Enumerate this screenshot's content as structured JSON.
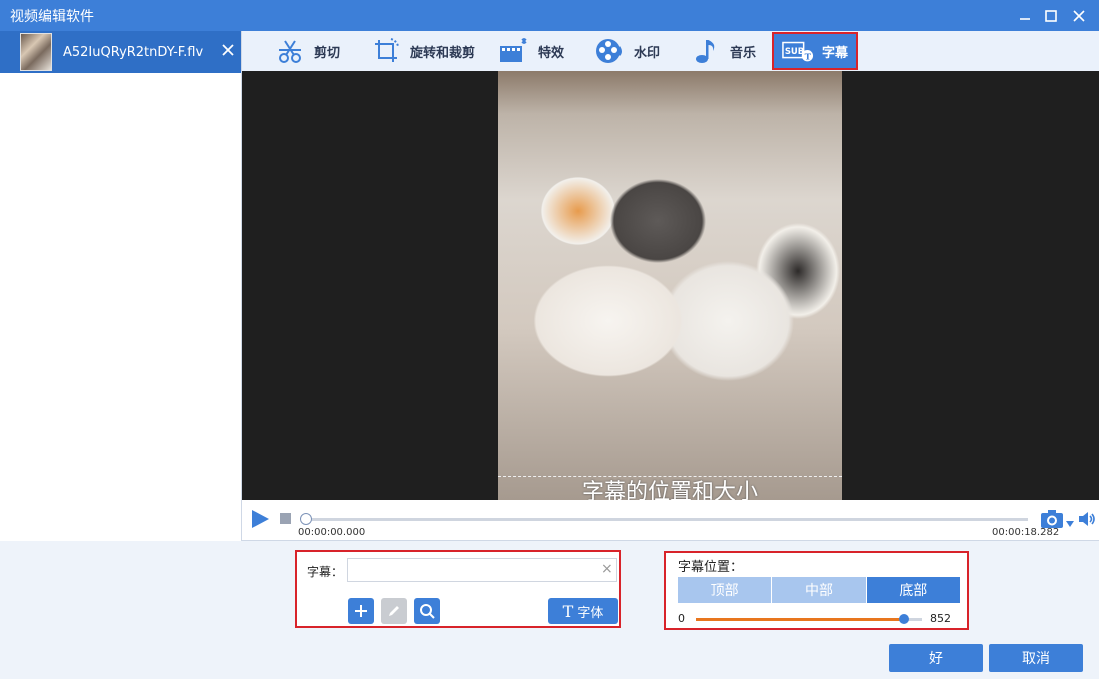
{
  "window": {
    "title": "视频编辑软件"
  },
  "files": [
    {
      "name": "A52IuQRyR2tnDY-F.flv",
      "selected": true
    }
  ],
  "tabs": [
    {
      "label": "剪切",
      "icon": "cut-icon"
    },
    {
      "label": "旋转和裁剪",
      "icon": "rotate-crop-icon"
    },
    {
      "label": "特效",
      "icon": "effects-icon"
    },
    {
      "label": "水印",
      "icon": "watermark-icon"
    },
    {
      "label": "音乐",
      "icon": "music-icon"
    },
    {
      "label": "字幕",
      "icon": "subtitle-icon",
      "active": true
    }
  ],
  "preview": {
    "subtitle_preview_text": "字幕的位置和大小"
  },
  "player": {
    "current_time": "00:00:00.000",
    "total_time": "00:00:18.282",
    "progress": 0
  },
  "subtitle": {
    "label": "字幕：",
    "value": "",
    "placeholder": "",
    "font_button": "字体"
  },
  "position": {
    "label": "字幕位置：",
    "options": [
      "顶部",
      "中部",
      "底部"
    ],
    "selected": "底部",
    "min": "0",
    "max": "852",
    "value": 852
  },
  "footer": {
    "ok": "好",
    "cancel": "取消"
  },
  "colors": {
    "accent": "#3d7fd8",
    "highlight_border": "#d8232a",
    "slider_fill": "#e8761e"
  }
}
